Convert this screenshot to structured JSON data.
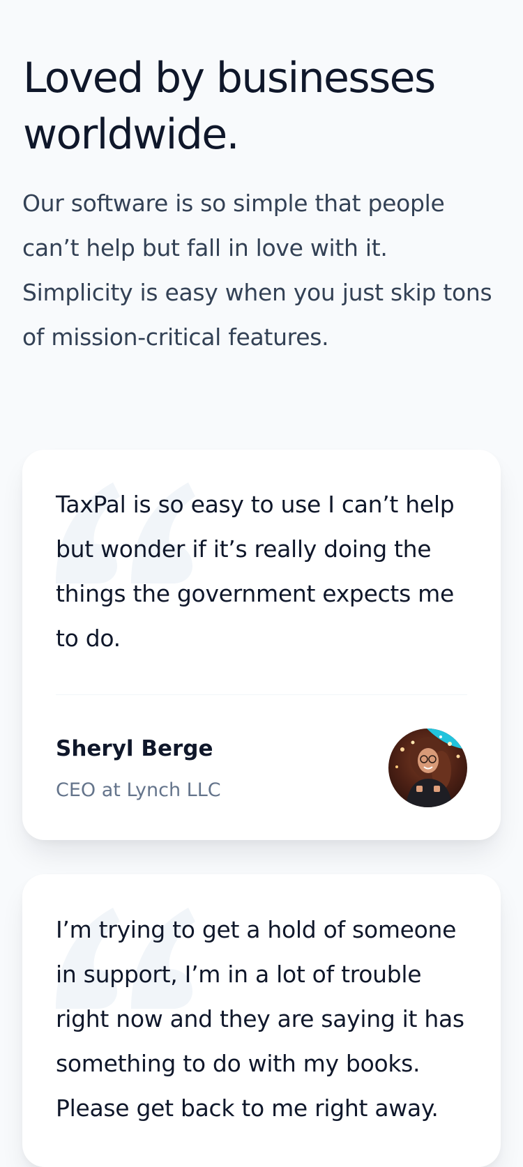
{
  "header": {
    "title": "Loved by businesses worldwide.",
    "subtitle": "Our software is so simple that people can’t help but fall in love with it. Simplicity is easy when you just skip tons of mission-critical features."
  },
  "testimonials": [
    {
      "quote": "TaxPal is so easy to use I can’t help but wonder if it’s really doing the things the government expects me to do.",
      "author_name": "Sheryl Berge",
      "author_role": "CEO at Lynch LLC",
      "avatar_icon": "avatar-photo"
    },
    {
      "quote": "I’m trying to get a hold of someone in support, I’m in a lot of trouble right now and they are saying it has something to do with my books. Please get back to me right away."
    }
  ],
  "colors": {
    "background": "#f8fafc",
    "heading": "#0f172a",
    "body_text": "#334155",
    "muted_text": "#64748b",
    "card": "#ffffff",
    "quote_mark": "#f1f5f9"
  }
}
